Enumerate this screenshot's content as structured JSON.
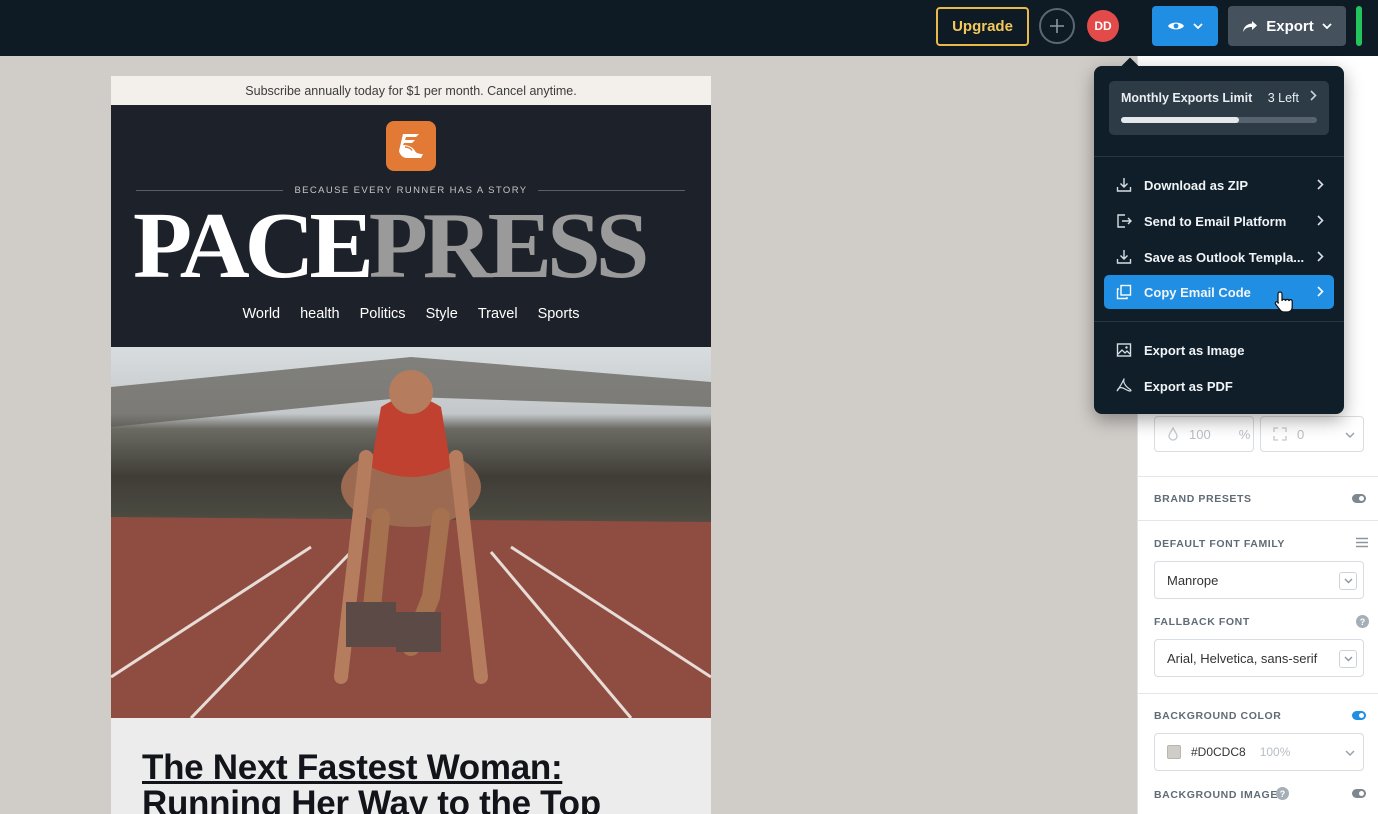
{
  "topbar": {
    "upgrade_label": "Upgrade",
    "avatar_initials": "DD",
    "export_label": "Export",
    "colors": {
      "bg": "#0e1b25",
      "upgrade_accent": "#e9b949",
      "preview_btn": "#1f8ee3",
      "export_btn": "#45525e",
      "status": "#23c45e",
      "avatar": "#e34b4b"
    }
  },
  "email": {
    "subscribe_text": "Subscribe annually today for $1 per month. Cancel anytime.",
    "tagline": "BECAUSE EVERY RUNNER HAS A STORY",
    "masthead_part1": "PACE",
    "masthead_part2": "PRESS",
    "nav": [
      "World",
      "health",
      "Politics",
      "Style",
      "Travel",
      "Sports"
    ],
    "headline_line1": "The Next Fastest Woman: ",
    "headline_line2": "Running Her Way to the Top",
    "logo_color": "#e27a36"
  },
  "export_menu": {
    "limit_title": "Monthly Exports Limit",
    "limit_remaining": "3 Left",
    "limit_usage_fraction": 0.6,
    "items": [
      {
        "label": "Download as ZIP",
        "icon": "download-icon",
        "has_submenu": true
      },
      {
        "label": "Send to Email Platform",
        "icon": "send-icon",
        "has_submenu": true
      },
      {
        "label": "Save as Outlook Templa...",
        "icon": "save-icon",
        "has_submenu": true
      },
      {
        "label": "Copy Email Code",
        "icon": "copy-icon",
        "has_submenu": true,
        "active": true
      }
    ],
    "items2": [
      {
        "label": "Export as Image",
        "icon": "image-icon"
      },
      {
        "label": "Export as PDF",
        "icon": "pdf-icon"
      }
    ]
  },
  "right_panel": {
    "padding_value": "0",
    "opacity_value": "100",
    "opacity_unit": "%",
    "px_unit": "px",
    "brand_presets_label": "BRAND PRESETS",
    "default_font_label": "DEFAULT FONT FAMILY",
    "default_font_value": "Manrope",
    "fallback_font_label": "FALLBACK FONT",
    "fallback_font_value": "Arial, Helvetica, sans-serif",
    "background_color_label": "BACKGROUND COLOR",
    "background_color_value": "#D0CDC8",
    "background_color_opacity": "100%",
    "background_image_label": "BACKGROUND IMAGE",
    "help_glyph": "?",
    "canvas_bg": "#d0cdc8"
  }
}
